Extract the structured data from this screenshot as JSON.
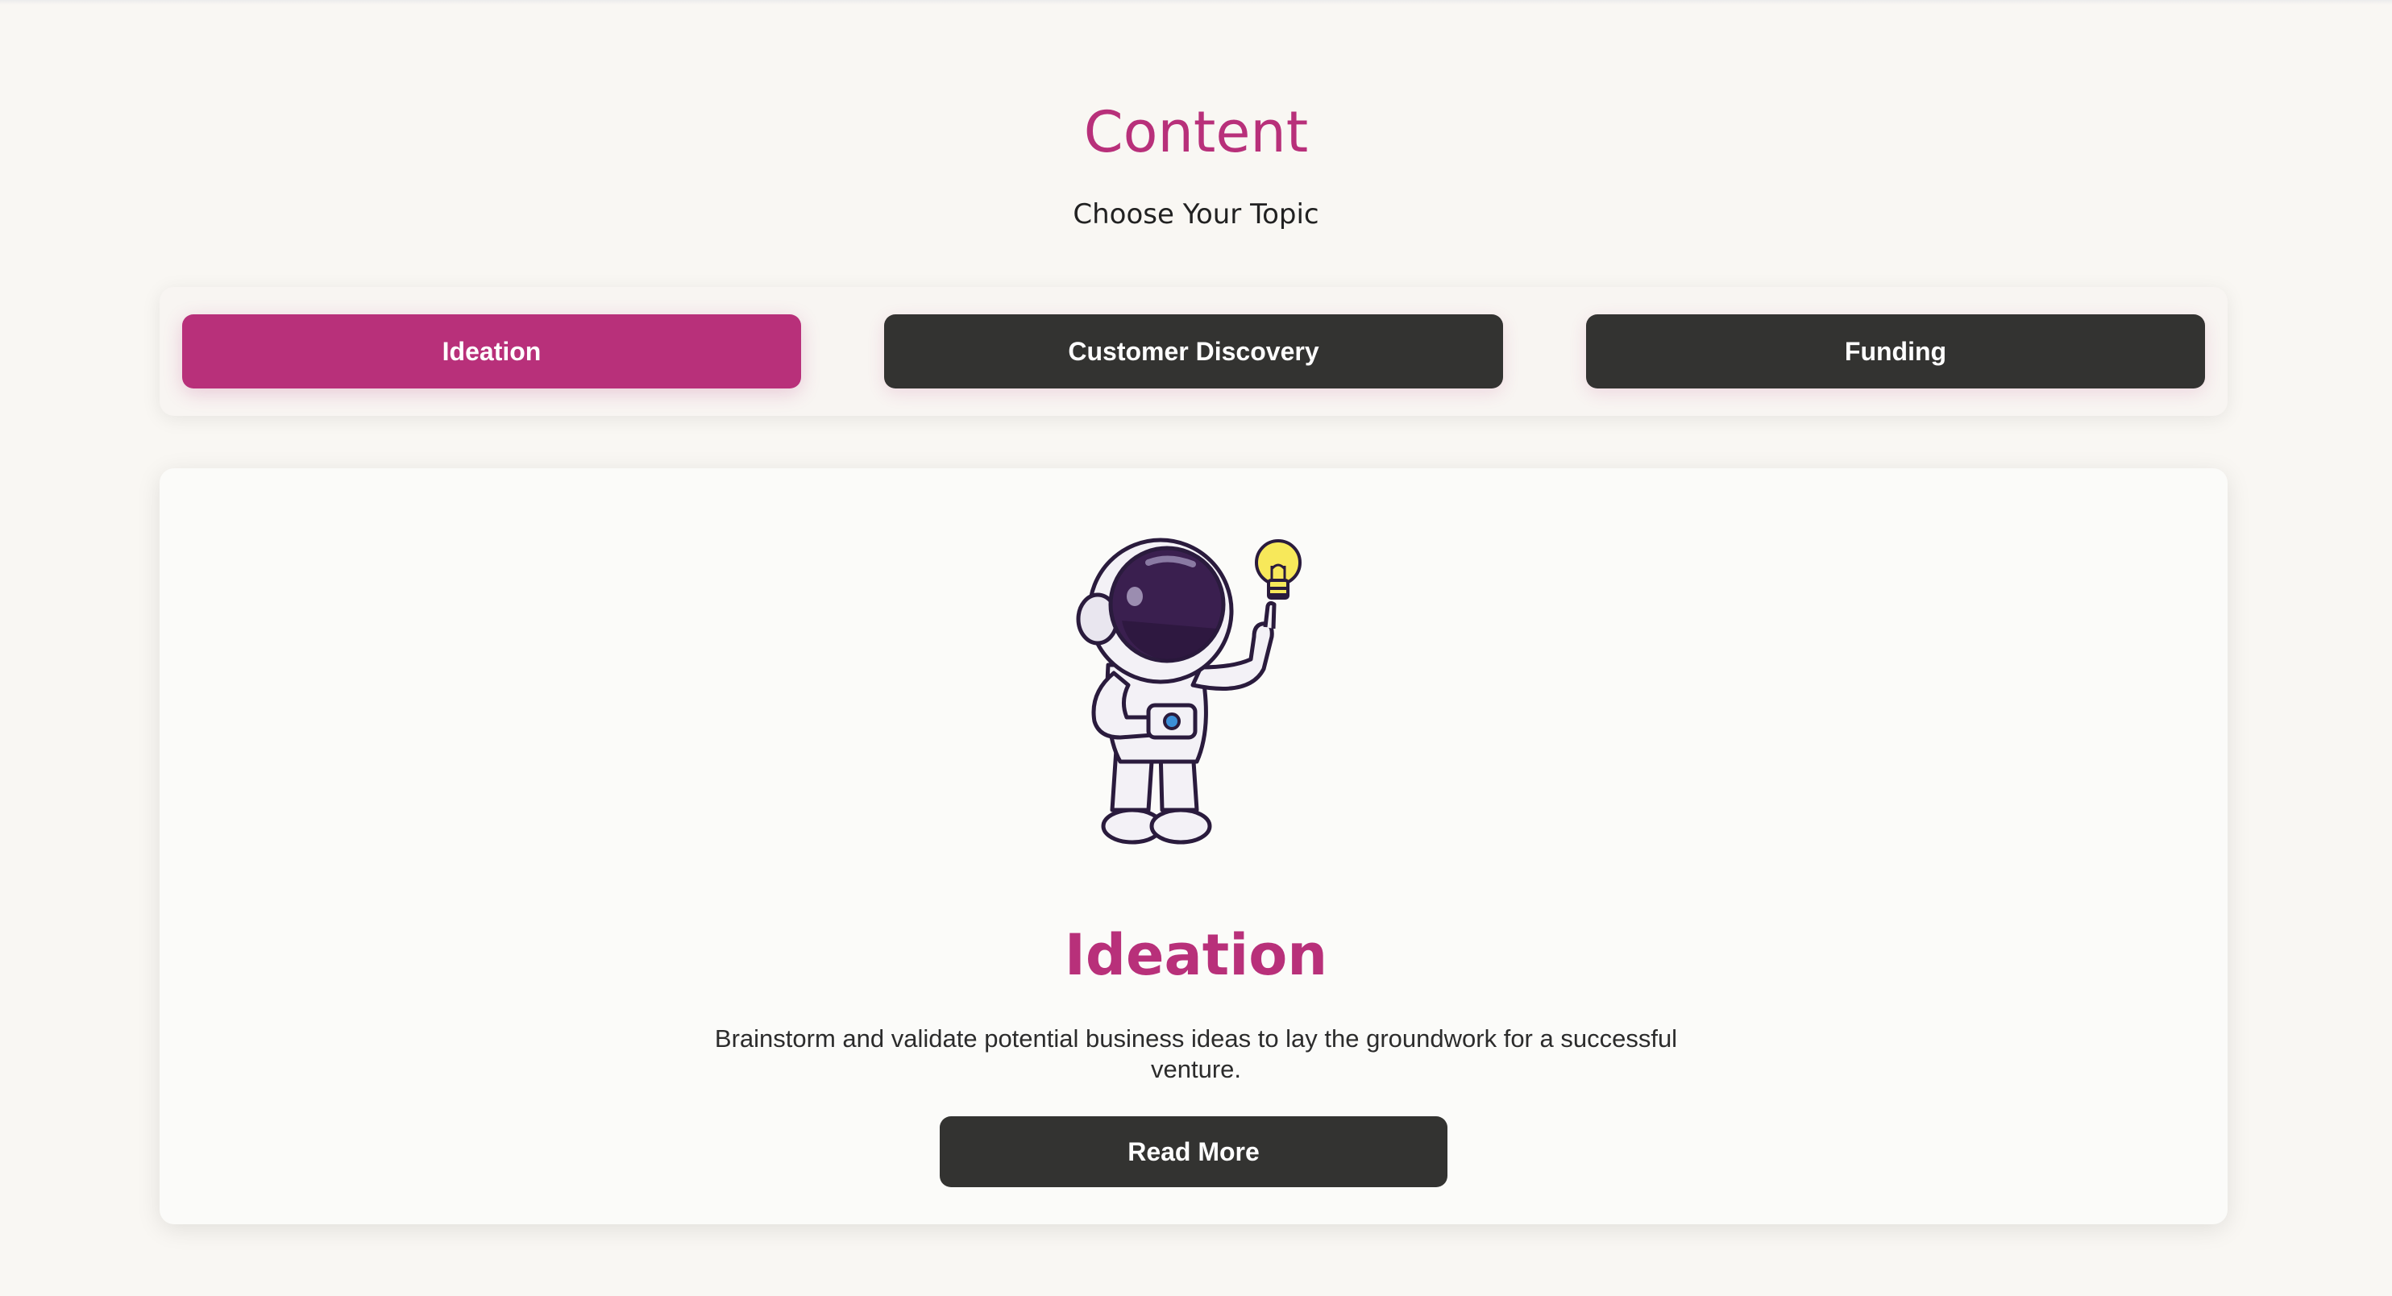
{
  "header": {
    "title": "Content",
    "subtitle": "Choose Your Topic"
  },
  "tabs": [
    {
      "label": "Ideation",
      "active": true
    },
    {
      "label": "Customer Discovery",
      "active": false
    },
    {
      "label": "Funding",
      "active": false
    }
  ],
  "card": {
    "illustration": "astronaut-lightbulb-icon",
    "title": "Ideation",
    "description": "Brainstorm and validate potential business ideas to lay the groundwork for a successful venture.",
    "button_label": "Read More"
  },
  "colors": {
    "accent": "#b8307a",
    "dark_button": "#333331",
    "background": "#f9f7f3",
    "bulb": "#f7e85a"
  }
}
